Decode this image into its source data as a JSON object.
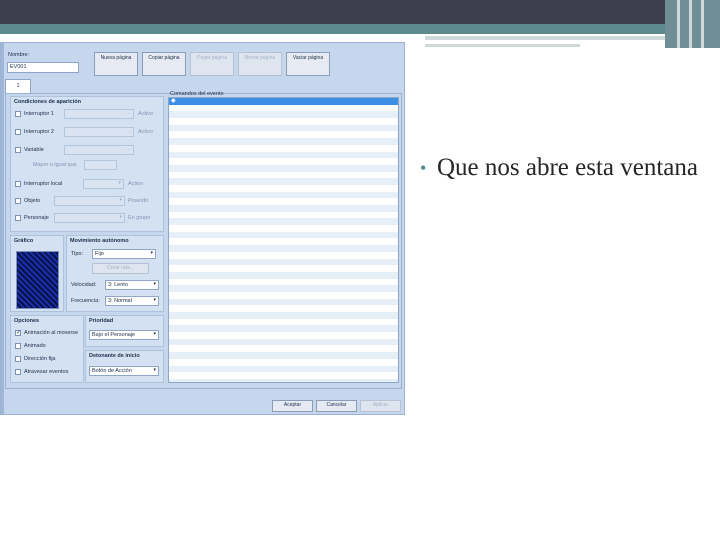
{
  "slide": {
    "bullet_text": "Que nos abre esta ventana"
  },
  "window": {
    "name_label": "Nombre:",
    "name_value": "EV001",
    "toolbar": {
      "new_page": "Nueva página",
      "copy_page": "Copiar página",
      "paste_page": "Pegar página",
      "delete_page": "Borrar página",
      "clear_page": "Vaciar página"
    },
    "tab_label": "1",
    "conditions": {
      "title": "Condiciones de aparición",
      "switch1": "Interruptor 1",
      "switch2": "Interruptor 2",
      "variable": "Variable",
      "variable_sub": "Mayor o igual que",
      "local_switch": "Interruptor local",
      "item": "Objeto",
      "actor": "Personaje",
      "active1": "Activo",
      "active2": "Activo",
      "active3": "Activo",
      "possessed": "Poseído",
      "in_group": "En grupo",
      "ellipsis": "..."
    },
    "graphic": {
      "title": "Gráfico"
    },
    "autonomous": {
      "title": "Movimiento autónomo",
      "type_label": "Tipo:",
      "type_value": "Fijo",
      "create_route": "Crear ruta...",
      "speed_label": "Velocidad:",
      "speed_value": "3: Lento",
      "freq_label": "Frecuencia:",
      "freq_value": "3: Normal"
    },
    "options": {
      "title": "Opciones",
      "walk_anim": "Animación al moverse",
      "step_anim": "Animado",
      "dir_fix": "Dirección fija",
      "through": "Atravesar eventos"
    },
    "priority": {
      "title": "Prioridad",
      "value": "Bajo el Personaje"
    },
    "trigger": {
      "title": "Detonante de inicio",
      "value": "Botón de Acción"
    },
    "event_list": {
      "title": "Comandos del evento",
      "first_row": "◆"
    },
    "footer": {
      "ok": "Aceptar",
      "cancel": "Cancelar",
      "apply": "Aplicar"
    }
  }
}
